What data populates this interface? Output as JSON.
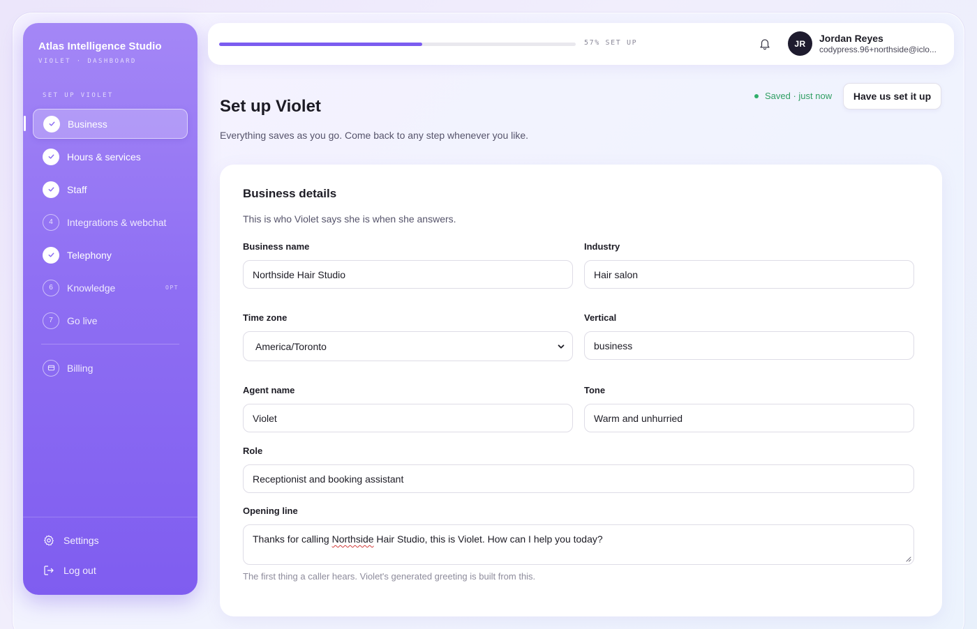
{
  "brand": {
    "title": "Atlas Intelligence Studio",
    "subtitle": "VIOLET · DASHBOARD"
  },
  "sidebar": {
    "section_label": "SET UP VIOLET",
    "items": [
      {
        "label": "Business",
        "state": "done",
        "active": true
      },
      {
        "label": "Hours & services",
        "state": "done"
      },
      {
        "label": "Staff",
        "state": "done"
      },
      {
        "label": "Integrations & webchat",
        "state": "pending",
        "number": "4"
      },
      {
        "label": "Telephony",
        "state": "done"
      },
      {
        "label": "Knowledge",
        "state": "pending",
        "number": "6",
        "badge": "OPT"
      },
      {
        "label": "Go live",
        "state": "pending",
        "number": "7"
      }
    ],
    "billing_label": "Billing",
    "settings_label": "Settings",
    "logout_label": "Log out"
  },
  "topbar": {
    "progress_percent": 57,
    "progress_text": "57% SET UP",
    "user_initials": "JR",
    "user_name": "Jordan Reyes",
    "user_email": "codypress.96+northside@iclo..."
  },
  "header": {
    "title": "Set up Violet",
    "subtitle": "Everything saves as you go. Come back to any step whenever you like.",
    "saved_status": "Saved · just now",
    "setup_button": "Have us set it up"
  },
  "form": {
    "title": "Business details",
    "subtitle": "This is who Violet says she is when she answers.",
    "business_name": {
      "label": "Business name",
      "value": "Northside Hair Studio"
    },
    "industry": {
      "label": "Industry",
      "value": "Hair salon"
    },
    "time_zone": {
      "label": "Time zone",
      "value": "America/Toronto"
    },
    "vertical": {
      "label": "Vertical",
      "value": "business"
    },
    "agent_name": {
      "label": "Agent name",
      "value": "Violet"
    },
    "tone": {
      "label": "Tone",
      "value": "Warm and unhurried"
    },
    "role": {
      "label": "Role",
      "value": "Receptionist and booking assistant"
    },
    "opening_line": {
      "label": "Opening line",
      "value_before": "Thanks for calling ",
      "value_flagged": "Northside",
      "value_after": " Hair Studio, this is Violet. How can I help you today?",
      "hint": "The first thing a caller hears. Violet's generated greeting is built from this."
    }
  },
  "colors": {
    "accent": "#7b5cf0",
    "sidebar_top": "#a487f6",
    "sidebar_bottom": "#7f5df0",
    "saved_green": "#2f9e62"
  },
  "icons": {
    "check": "check-icon",
    "bell": "bell-icon",
    "billing": "card-icon",
    "settings": "gear-icon",
    "logout": "logout-icon",
    "select": "chevron-down-icon"
  }
}
